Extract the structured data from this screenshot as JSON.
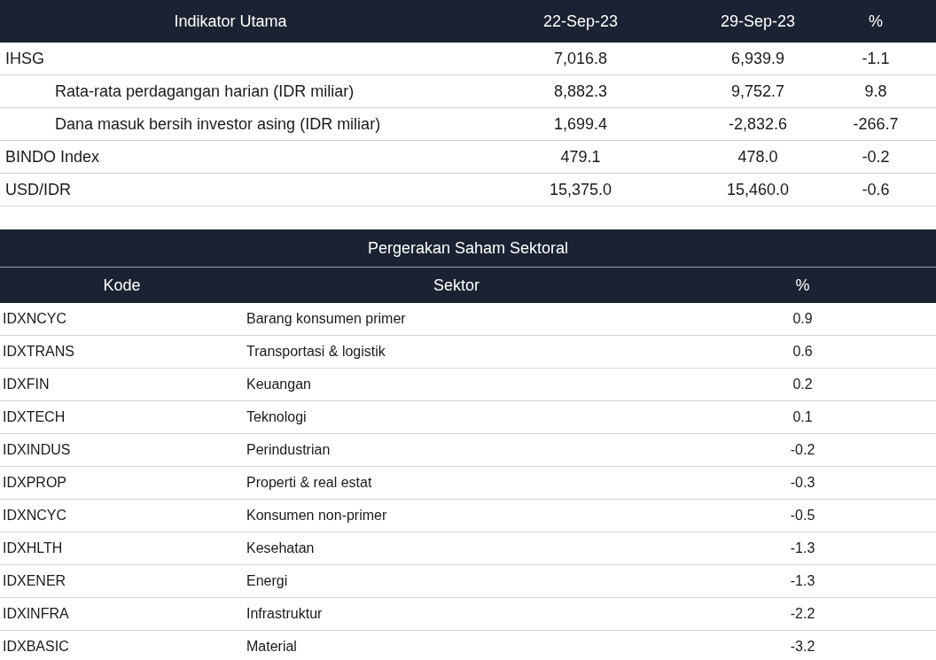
{
  "indicators": {
    "columns": [
      "Indikator Utama",
      "22-Sep-23",
      "29-Sep-23",
      "%"
    ],
    "rows": [
      {
        "label": "IHSG",
        "indented": false,
        "values": [
          "7,016.8",
          "6,939.9",
          "-1.1"
        ]
      },
      {
        "label": "Rata-rata perdagangan harian (IDR miliar)",
        "indented": true,
        "values": [
          "8,882.3",
          "9,752.7",
          "9.8"
        ]
      },
      {
        "label": "Dana masuk bersih investor asing (IDR miliar)",
        "indented": true,
        "values": [
          "1,699.4",
          "-2,832.6",
          "-266.7"
        ]
      },
      {
        "label": "BINDO Index",
        "indented": false,
        "values": [
          "479.1",
          "478.0",
          "-0.2"
        ]
      },
      {
        "label": "USD/IDR",
        "indented": false,
        "values": [
          "15,375.0",
          "15,460.0",
          "-0.6"
        ]
      }
    ]
  },
  "sectors": {
    "title": "Pergerakan Saham Sektoral",
    "columns": [
      "Kode",
      "Sektor",
      "%"
    ],
    "rows": [
      {
        "code": "IDXNCYC",
        "sector": "Barang konsumen primer",
        "change": "0.9"
      },
      {
        "code": "IDXTRANS",
        "sector": "Transportasi & logistik",
        "change": "0.6"
      },
      {
        "code": "IDXFIN",
        "sector": "Keuangan",
        "change": "0.2"
      },
      {
        "code": "IDXTECH",
        "sector": "Teknologi",
        "change": "0.1"
      },
      {
        "code": "IDXINDUS",
        "sector": "Perindustrian",
        "change": "-0.2"
      },
      {
        "code": "IDXPROP",
        "sector": "Properti & real estat",
        "change": "-0.3"
      },
      {
        "code": "IDXNCYC",
        "sector": "Konsumen non-primer",
        "change": "-0.5"
      },
      {
        "code": "IDXHLTH",
        "sector": "Kesehatan",
        "change": "-1.3"
      },
      {
        "code": "IDXENER",
        "sector": "Energi",
        "change": "-1.3"
      },
      {
        "code": "IDXINFRA",
        "sector": "Infrastruktur",
        "change": "-2.2"
      },
      {
        "code": "IDXBASIC",
        "sector": "Material",
        "change": "-3.2"
      }
    ]
  }
}
